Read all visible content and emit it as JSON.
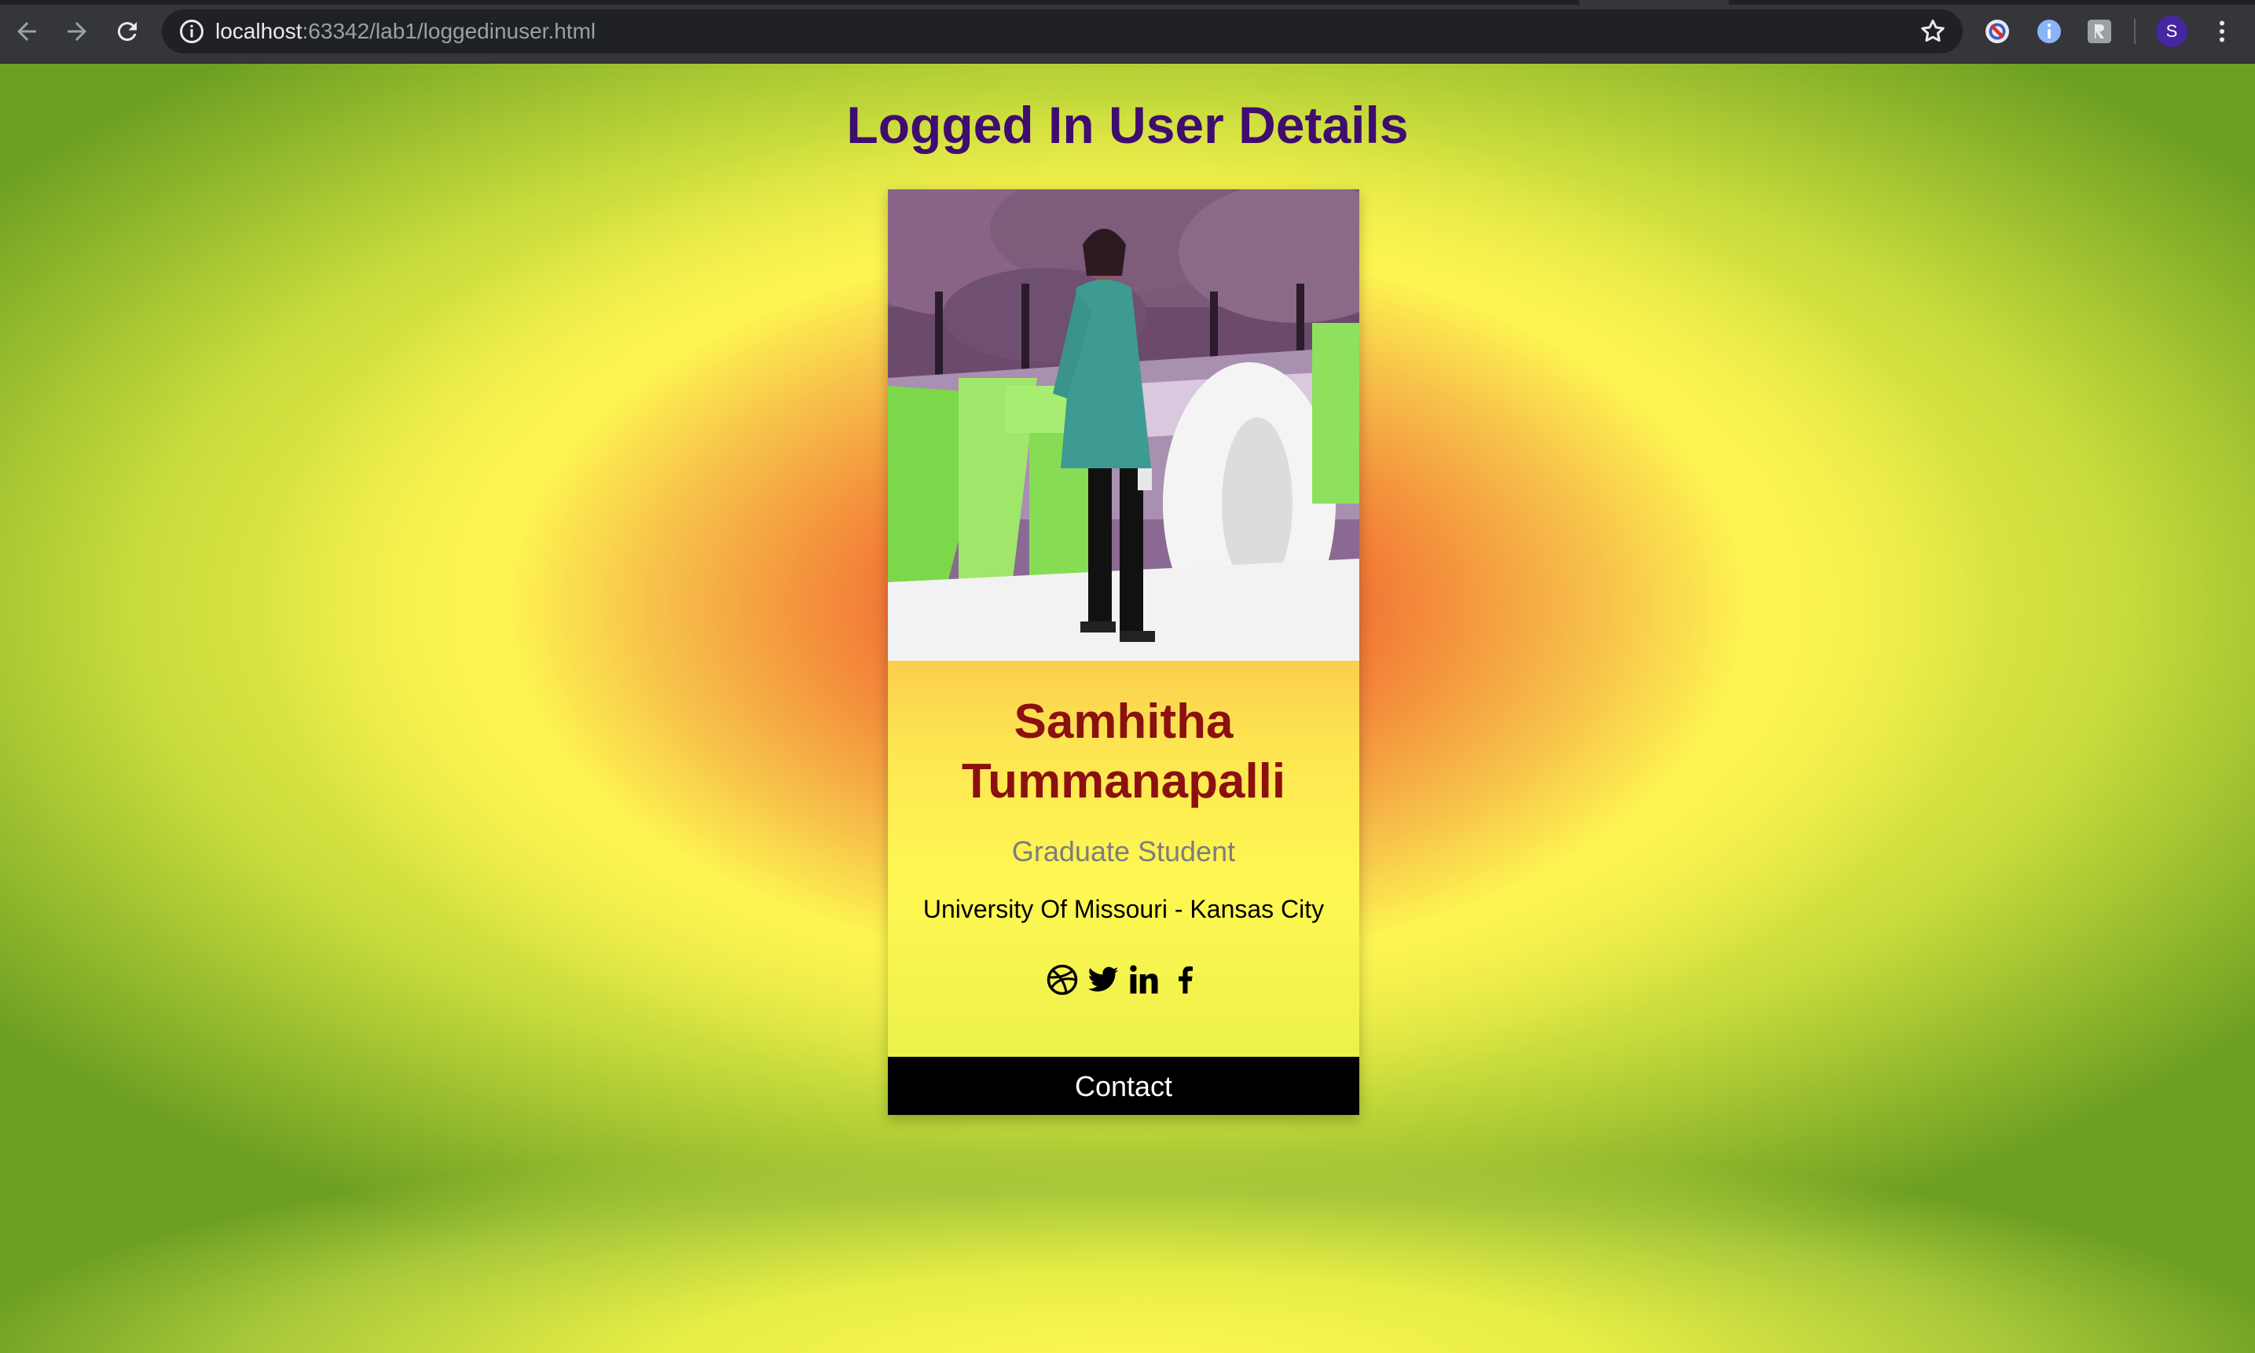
{
  "browser": {
    "url_host": "localhost",
    "url_path": ":63342/lab1/loggedinuser.html",
    "profile_initial": "S",
    "icons": [
      "back-icon",
      "forward-icon",
      "reload-icon",
      "info-icon",
      "bookmark-star-icon",
      "block-extension-icon",
      "info-extension-icon",
      "puzzle-extension-icon",
      "menu-dots-icon"
    ]
  },
  "page": {
    "title": "Logged In User Details"
  },
  "card": {
    "name": "Samhitha Tummanapalli",
    "role": "Graduate Student",
    "university": "University Of Missouri - Kansas City",
    "socials": [
      "dribbble-icon",
      "twitter-icon",
      "linkedin-icon",
      "facebook-icon"
    ],
    "contact_label": "Contact"
  },
  "colors": {
    "title": "#3f0c6f",
    "name": "#8b1010",
    "role": "#7d7d7d",
    "button_bg": "#000000",
    "chrome_bg": "#35363a"
  }
}
